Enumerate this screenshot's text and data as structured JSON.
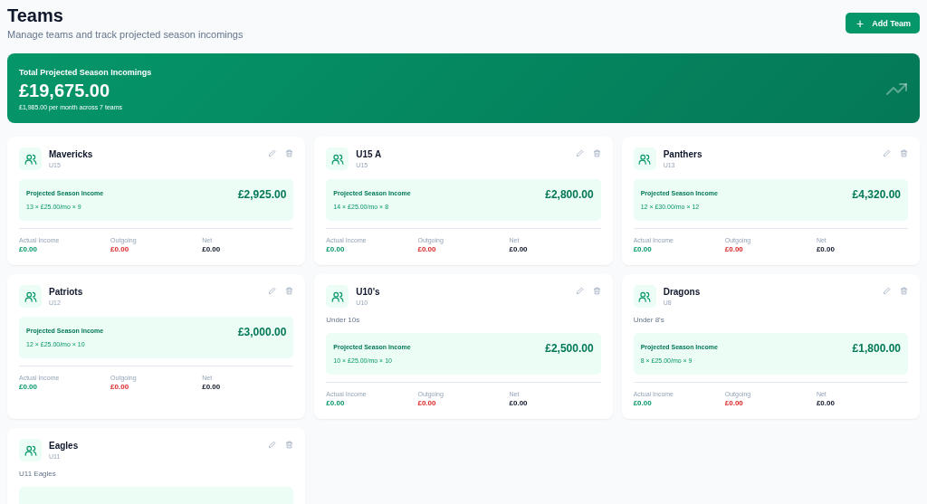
{
  "header": {
    "title": "Teams",
    "subtitle": "Manage teams and track projected season incomings",
    "add_button": {
      "icon": "+",
      "label": "Add Team"
    }
  },
  "summary": {
    "label": "Total Projected Season Incomings",
    "amount": "£19,675.00",
    "detail": "£1,985.00 per month across 7 teams"
  },
  "teams": [
    {
      "name": "Mavericks",
      "age_group": "U15",
      "projected": {
        "label": "Projected Season Income",
        "amount": "£2,925.00",
        "formula": "13 × £25.00/mo × 9"
      },
      "stats": [
        {
          "label": "Actual Income",
          "value": "£0.00",
          "kind": "income"
        },
        {
          "label": "Outgoing",
          "value": "£0.00",
          "kind": "outgoing"
        },
        {
          "label": "Net",
          "value": "£0.00",
          "kind": "net"
        }
      ]
    },
    {
      "name": "U15 A",
      "age_group": "U15",
      "projected": {
        "label": "Projected Season Income",
        "amount": "£2,800.00",
        "formula": "14 × £25.00/mo × 8"
      },
      "stats": [
        {
          "label": "Actual Income",
          "value": "£0.00",
          "kind": "income"
        },
        {
          "label": "Outgoing",
          "value": "£0.00",
          "kind": "outgoing"
        },
        {
          "label": "Net",
          "value": "£0.00",
          "kind": "net"
        }
      ]
    },
    {
      "name": "Panthers",
      "age_group": "U13",
      "projected": {
        "label": "Projected Season Income",
        "amount": "£4,320.00",
        "formula": "12 × £30.00/mo × 12"
      },
      "stats": [
        {
          "label": "Actual Income",
          "value": "£0.00",
          "kind": "income"
        },
        {
          "label": "Outgoing",
          "value": "£0.00",
          "kind": "outgoing"
        },
        {
          "label": "Net",
          "value": "£0.00",
          "kind": "net"
        }
      ]
    },
    {
      "name": "Patriots",
      "age_group": "U12",
      "projected": {
        "label": "Projected Season Income",
        "amount": "£3,000.00",
        "formula": "12 × £25.00/mo × 10"
      },
      "stats": [
        {
          "label": "Actual Income",
          "value": "£0.00",
          "kind": "income"
        },
        {
          "label": "Outgoing",
          "value": "£0.00",
          "kind": "outgoing"
        },
        {
          "label": "Net",
          "value": "£0.00",
          "kind": "net"
        }
      ]
    },
    {
      "name": "U10's",
      "age_group": "U10",
      "description": "Under 10s",
      "projected": {
        "label": "Projected Season Income",
        "amount": "£2,500.00",
        "formula": "10 × £25.00/mo × 10"
      },
      "stats": [
        {
          "label": "Actual Income",
          "value": "£0.00",
          "kind": "income"
        },
        {
          "label": "Outgoing",
          "value": "£0.00",
          "kind": "outgoing"
        },
        {
          "label": "Net",
          "value": "£0.00",
          "kind": "net"
        }
      ]
    },
    {
      "name": "Dragons",
      "age_group": "U8",
      "description": "Under 8's",
      "projected": {
        "label": "Projected Season Income",
        "amount": "£1,800.00",
        "formula": "8 × £25.00/mo × 9"
      },
      "stats": [
        {
          "label": "Actual Income",
          "value": "£0.00",
          "kind": "income"
        },
        {
          "label": "Outgoing",
          "value": "£0.00",
          "kind": "outgoing"
        },
        {
          "label": "Net",
          "value": "£0.00",
          "kind": "net"
        }
      ]
    },
    {
      "name": "Eagles",
      "age_group": "U11",
      "description": "U11 Eagles"
    }
  ]
}
